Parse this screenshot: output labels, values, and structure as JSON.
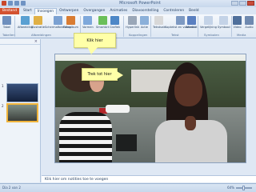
{
  "app": {
    "title": "Microsoft PowerPoint"
  },
  "tabs": [
    "Bestand",
    "Start",
    "Invoegen",
    "Ontwerpen",
    "Overgangen",
    "Animaties",
    "Diavoorstelling",
    "Controleren",
    "Beeld"
  ],
  "ribbon": {
    "buttons": [
      {
        "label": "Tabel"
      },
      {
        "label": "Afbeelding"
      },
      {
        "label": "Illustratie"
      },
      {
        "label": "Schermafbeelding"
      },
      {
        "label": "Fotoalbum"
      },
      {
        "label": "Vormen"
      },
      {
        "label": "SmartArt"
      },
      {
        "label": "Grafiek"
      },
      {
        "label": "Hyperlink"
      },
      {
        "label": "Actie"
      },
      {
        "label": "Tekstvak"
      },
      {
        "label": "Koptekst en voettekst"
      },
      {
        "label": "WordArt"
      },
      {
        "label": "Vergelijking"
      },
      {
        "label": "Symbool"
      },
      {
        "label": "Video"
      },
      {
        "label": "Audio"
      }
    ],
    "groups": [
      "Tabellen",
      "Afbeeldingen",
      "Illustraties",
      "Koppelingen",
      "Tekst",
      "Symbolen",
      "Media"
    ]
  },
  "slides": [
    {
      "number": "1"
    },
    {
      "number": "2"
    }
  ],
  "callouts": {
    "top": "Klik hier",
    "middle": "Trek tot hier"
  },
  "notes": {
    "placeholder": "Klik hier om notities toe te voegen"
  },
  "status": {
    "slide_info": "Dia 2 van 2",
    "zoom": "64%"
  },
  "icons": {
    "file": "file-icon",
    "save": "save-icon",
    "undo": "undo-icon",
    "redo": "redo-icon"
  }
}
